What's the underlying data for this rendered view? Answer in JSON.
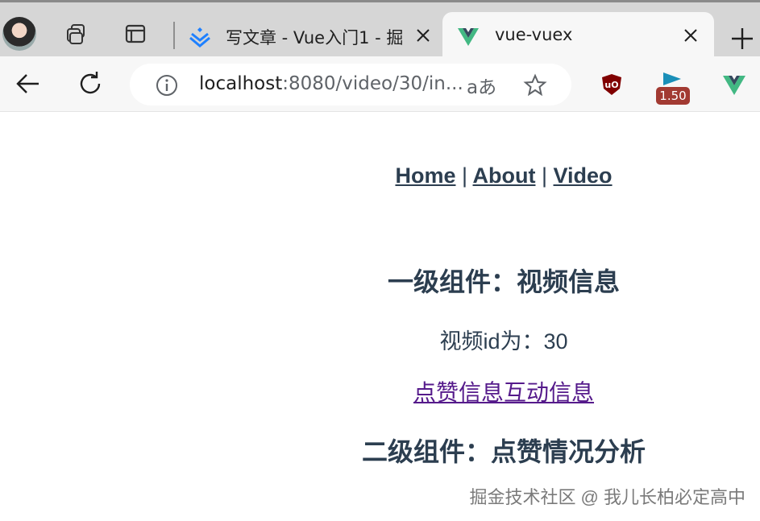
{
  "browser": {
    "tabs": [
      {
        "title": "写文章 - Vue入门1 - 掘金",
        "favicon": "juejin-logo-icon",
        "active": false
      },
      {
        "title": "vue-vuex",
        "favicon": "vue-logo-icon",
        "active": true
      }
    ],
    "address": {
      "host": "localhost",
      "rest": ":8080/video/30/in..."
    },
    "read_aloud": "aあ",
    "extension_badge": "1.50"
  },
  "page": {
    "nav": {
      "home": "Home",
      "about": "About",
      "video": "Video",
      "separator": "|"
    },
    "level1_heading": "一级组件：视频信息",
    "video_id_label": "视频id为：",
    "video_id": "30",
    "link_likes": "点赞信息",
    "link_interactions": "互动信息",
    "level2_heading": "二级组件：点赞情况分析"
  },
  "watermark": "掘金技术社区 @ 我儿长柏必定高中",
  "colors": {
    "text": "#2c3e50",
    "visited_link": "#551a8b",
    "vue_green": "#42b883",
    "badge": "#a23a32"
  }
}
